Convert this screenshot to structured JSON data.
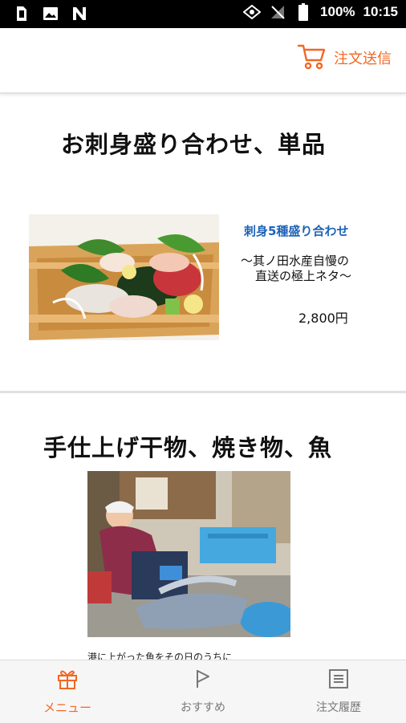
{
  "status_bar": {
    "icons_left": [
      "sim-card-icon",
      "image-icon",
      "n-app-icon"
    ],
    "battery": "100%",
    "time": "10:15"
  },
  "header": {
    "order_send_label": "注文送信",
    "accent_color": "#f26722"
  },
  "sections": [
    {
      "title": "お刺身盛り合わせ、単品",
      "items": [
        {
          "name": "刺身5種盛り合わせ",
          "description_line1": "～其ノ田水産自慢の",
          "description_line2": "直送の極上ネタ～",
          "price": "2,800円"
        }
      ]
    },
    {
      "title": "手仕上げ干物、焼き物、魚",
      "caption": "港に上がった魚をその日のうちに"
    }
  ],
  "bottom_nav": {
    "items": [
      {
        "label": "メニュー",
        "icon": "gift-icon",
        "active": true
      },
      {
        "label": "おすすめ",
        "icon": "flag-icon",
        "active": false
      },
      {
        "label": "注文履歴",
        "icon": "list-icon",
        "active": false
      }
    ]
  }
}
